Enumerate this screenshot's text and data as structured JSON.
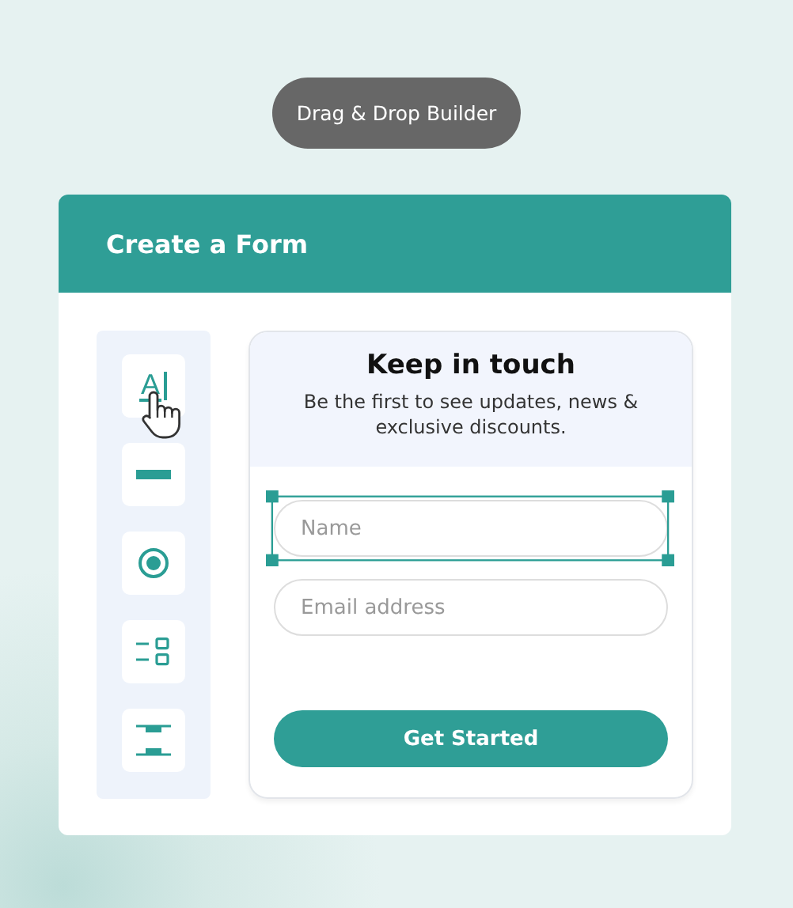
{
  "badge": "Drag & Drop Builder",
  "card": {
    "title": "Create a Form"
  },
  "tools": [
    {
      "kind": "text",
      "glyph": "A",
      "selected": true
    },
    {
      "kind": "divider",
      "selected": false
    },
    {
      "kind": "radio",
      "selected": false
    },
    {
      "kind": "options",
      "selected": false
    },
    {
      "kind": "spacer",
      "selected": false
    }
  ],
  "form": {
    "title": "Keep in touch",
    "subtitle": "Be the first to see updates, news & exclusive discounts.",
    "fields": [
      {
        "placeholder": "Name",
        "selected": true
      },
      {
        "placeholder": "Email address",
        "selected": false
      }
    ],
    "button": "Get Started"
  }
}
